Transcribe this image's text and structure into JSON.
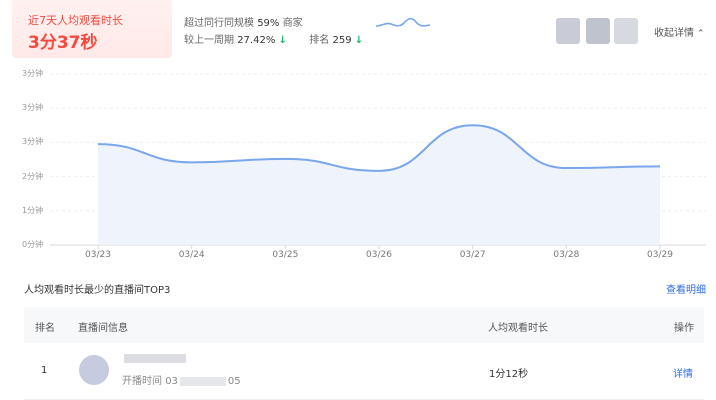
{
  "summary": {
    "label": "近7天人均观看时长",
    "value": "3分37秒"
  },
  "compare": {
    "peer_text": "超过同行同规模",
    "peer_percent": "59%",
    "peer_unit": "商家",
    "period_text": "较上一周期",
    "period_value": "27.42%",
    "rank_label": "排名",
    "rank_value": "259",
    "down_arrow": "↓"
  },
  "header": {
    "collapse_label": "收起详情"
  },
  "chart_data": {
    "type": "area",
    "categories": [
      "03/23",
      "03/24",
      "03/25",
      "03/26",
      "03/27",
      "03/28",
      "03/29"
    ],
    "values": [
      177,
      145,
      151,
      130,
      210,
      135,
      138
    ],
    "y_ticks": [
      "0分钟",
      "1分钟",
      "2分钟",
      "3分钟",
      "3分钟",
      "3分钟"
    ],
    "y_tick_values": [
      0,
      60,
      120,
      180,
      240,
      300
    ],
    "ylim": [
      0,
      300
    ],
    "smooth": true,
    "line_color": "#7aa6ec",
    "fill_color": "#eef3fc",
    "grid": true
  },
  "table": {
    "title": "人均观看时长最少的直播间TOP3",
    "view_detail_label": "查看明细",
    "columns": [
      "排名",
      "直播间信息",
      "人均观看时长",
      "操作"
    ],
    "rows": [
      {
        "rank": "1",
        "time_prefix": "开播时间",
        "time_start": "03",
        "time_end": "05",
        "duration": "1分12秒",
        "action": "详情"
      }
    ]
  }
}
